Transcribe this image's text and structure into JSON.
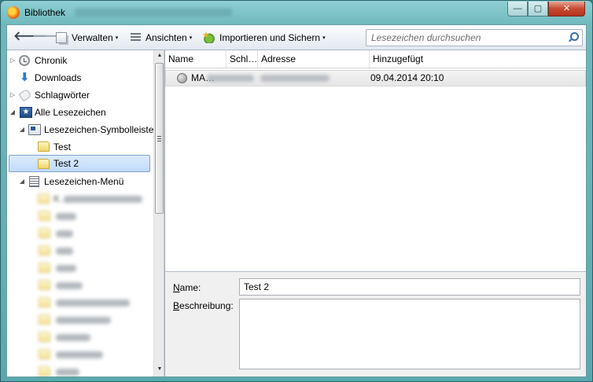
{
  "window": {
    "title": "Bibliothek",
    "controls": {
      "minimize": "—",
      "maximize": "▢",
      "close": "✕"
    }
  },
  "toolbar": {
    "back_glyph": "🡐",
    "forward_glyph": "🡒",
    "manage_label": "Verwalten",
    "views_label": "Ansichten",
    "import_label": "Importieren und Sichern",
    "caret": "▾"
  },
  "search": {
    "placeholder": "Lesezeichen durchsuchen"
  },
  "sidebar": {
    "items": [
      {
        "label": "Chronik",
        "icon": "history-icon"
      },
      {
        "label": "Downloads",
        "icon": "download-icon"
      },
      {
        "label": "Schlagwörter",
        "icon": "tag-icon"
      },
      {
        "label": "Alle Lesezeichen",
        "icon": "all-bookmarks-icon"
      },
      {
        "label": "Lesezeichen-Symbolleiste",
        "icon": "bookmarks-toolbar-icon"
      },
      {
        "label": "Test",
        "icon": "folder-icon"
      },
      {
        "label": "Test 2",
        "icon": "folder-icon",
        "selected": true
      },
      {
        "label": "Lesezeichen-Menü",
        "icon": "bookmarks-menu-icon"
      },
      {
        "label": "K…",
        "icon": "folder-icon"
      }
    ],
    "twisty_collapsed": "▷",
    "twisty_expanded": "◢"
  },
  "list": {
    "columns": [
      "Name",
      "Schl…",
      "Adresse",
      "Hinzugefügt"
    ],
    "rows": [
      {
        "name": "MA…",
        "keyword": "",
        "address": "",
        "added": "09.04.2014 20:10"
      }
    ]
  },
  "details": {
    "name_label_u": "N",
    "name_label_rest": "ame:",
    "name_value": "Test 2",
    "desc_label_u": "B",
    "desc_label_rest": "eschreibung:",
    "desc_value": ""
  },
  "scrollbar": {
    "up": "▲",
    "down": "▼",
    "grip": "≡"
  }
}
